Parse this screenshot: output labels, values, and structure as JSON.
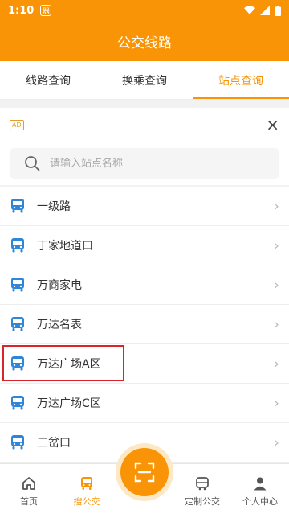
{
  "status_bar": {
    "time": "1:10",
    "notification_glyph": "器"
  },
  "header": {
    "title": "公交线路"
  },
  "tabs": [
    {
      "label": "线路查询",
      "active": false
    },
    {
      "label": "换乘查询",
      "active": false
    },
    {
      "label": "站点查询",
      "active": true
    }
  ],
  "ad": {
    "badge": "AD",
    "close_label": "×"
  },
  "search": {
    "placeholder": "请输入站点名称",
    "value": ""
  },
  "stations": [
    {
      "name": "一级路"
    },
    {
      "name": "丁家地道口"
    },
    {
      "name": "万商家电"
    },
    {
      "name": "万达名表"
    },
    {
      "name": "万达广场A区"
    },
    {
      "name": "万达广场C区"
    },
    {
      "name": "三岔口"
    }
  ],
  "bottom_nav": {
    "home": "首页",
    "search_bus": "搜公交",
    "custom_bus": "定制公交",
    "profile": "个人中心"
  },
  "colors": {
    "accent": "#f89406",
    "bus_icon": "#2f86d8",
    "highlight": "#d9242c"
  },
  "icons": {
    "status": [
      "notification-icon",
      "wifi-icon",
      "signal-icon",
      "battery-icon"
    ],
    "list": "bus-icon",
    "chevron": "chevron-right-icon",
    "nav": [
      "home-icon",
      "bus-icon",
      "scan-icon",
      "custom-bus-icon",
      "person-icon"
    ]
  }
}
